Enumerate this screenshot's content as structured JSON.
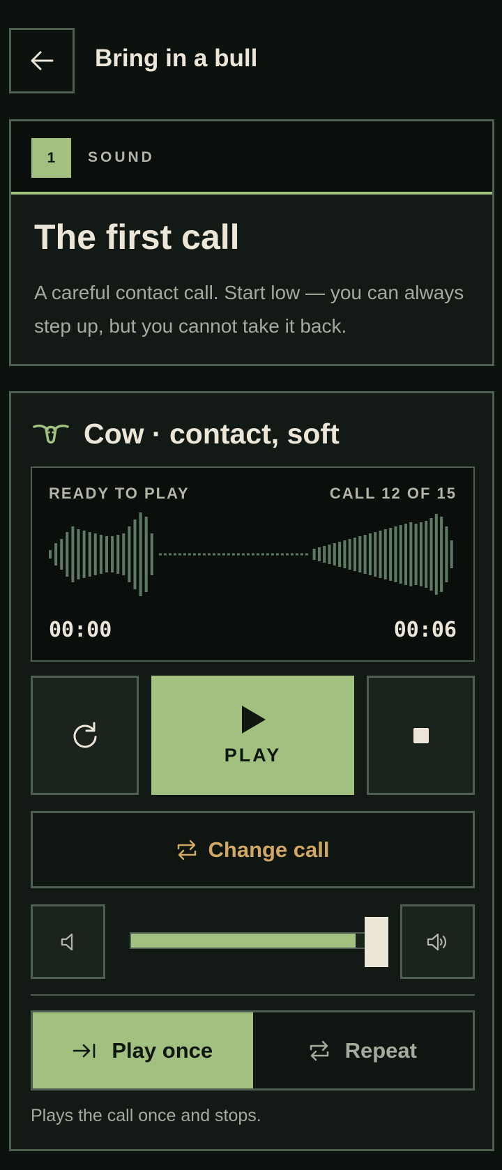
{
  "header": {
    "title": "Bring in a bull",
    "back_icon": "arrow-left-icon"
  },
  "step": {
    "number": "1",
    "kind": "SOUND",
    "heading": "The first call",
    "description": "A careful contact call. Start low — you can always step up, but you cannot take it back."
  },
  "player": {
    "call_icon": "cow-head-icon",
    "call_name": "Cow · contact, soft",
    "status": "READY TO PLAY",
    "call_count": "CALL 12 OF 15",
    "time_start": "00:00",
    "time_end": "00:06",
    "play_label": "PLAY",
    "change_label": "Change call",
    "volume_level": 0.9,
    "modes": {
      "once_label": "Play once",
      "repeat_label": "Repeat",
      "selected": "once"
    },
    "mode_hint": "Plays the call once and stops."
  },
  "colors": {
    "background": "#0c120e",
    "accent": "#a2c180",
    "warm": "#d1a763",
    "border": "#4c5f51",
    "text": "#ece6d8"
  }
}
